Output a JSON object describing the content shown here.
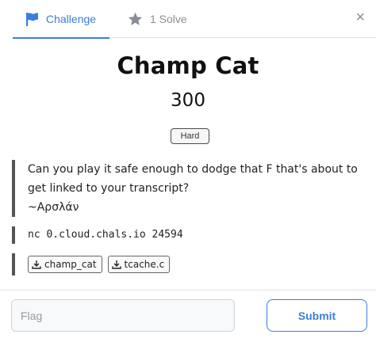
{
  "tabs": [
    {
      "label": "Challenge",
      "icon": "flag-icon",
      "active": true
    },
    {
      "label": "1 Solve",
      "icon": "star-icon",
      "active": false
    }
  ],
  "close_glyph": "×",
  "challenge": {
    "name": "Champ Cat",
    "points": "300",
    "difficulty": "Hard",
    "description_line1": "Can you play it safe enough to dodge that F that's about to get linked to your transcript?",
    "author": "~Αρσλάν",
    "connection": "nc 0.cloud.chals.io 24594",
    "files": [
      "champ_cat",
      "tcache.c"
    ]
  },
  "form": {
    "flag_placeholder": "Flag",
    "submit_label": "Submit"
  },
  "colors": {
    "accent": "#3b7ddd",
    "muted": "#8a8f95"
  }
}
